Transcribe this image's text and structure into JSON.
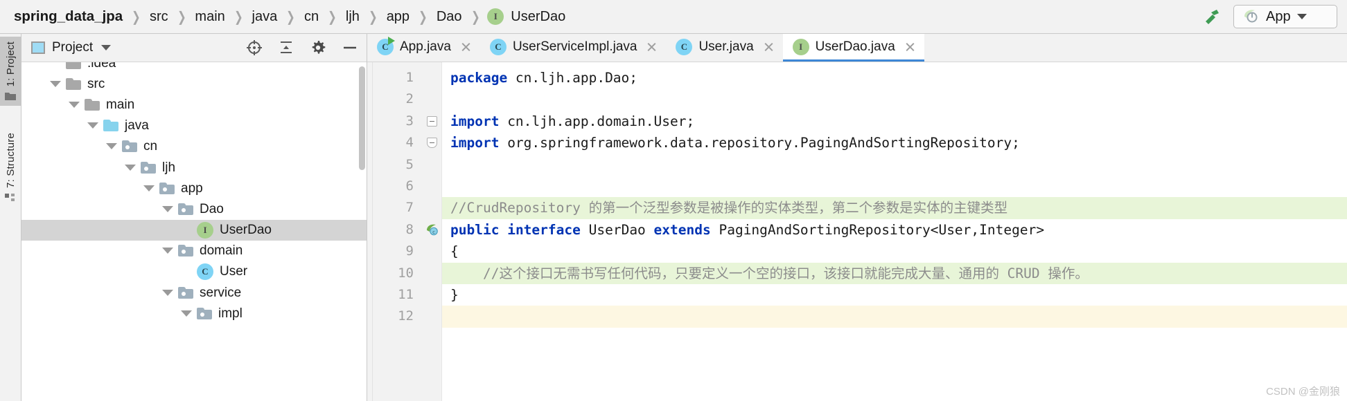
{
  "navbar": {
    "breadcrumb": [
      {
        "label": "spring_data_jpa",
        "root": true,
        "icon": ""
      },
      {
        "label": "src",
        "root": false,
        "icon": ""
      },
      {
        "label": "main",
        "root": false,
        "icon": ""
      },
      {
        "label": "java",
        "root": false,
        "icon": ""
      },
      {
        "label": "cn",
        "root": false,
        "icon": ""
      },
      {
        "label": "ljh",
        "root": false,
        "icon": ""
      },
      {
        "label": "app",
        "root": false,
        "icon": ""
      },
      {
        "label": "Dao",
        "root": false,
        "icon": ""
      },
      {
        "label": "UserDao",
        "root": false,
        "icon": "interface-icon"
      }
    ],
    "separator": "❯",
    "build_icon": "hammer-icon",
    "run_config": {
      "name": "App",
      "icon": "spring-boot-icon",
      "dropdown_icon": "chevron-down-icon"
    }
  },
  "tool_stripe": {
    "buttons": [
      {
        "label": "1: Project",
        "accel": "1",
        "icon": "folder-icon",
        "active": true
      },
      {
        "label": "7: Structure",
        "accel": "7",
        "icon": "structure-icon",
        "active": false
      }
    ]
  },
  "project_panel": {
    "title": "Project",
    "title_icon": "project-view-icon",
    "dropdown_icon": "chevron-down-icon",
    "actions": [
      {
        "name": "select-opened-file-icon",
        "tooltip": "Select Opened File"
      },
      {
        "name": "collapse-all-icon",
        "tooltip": "Collapse All"
      },
      {
        "name": "settings-gear-icon",
        "tooltip": "Settings"
      },
      {
        "name": "hide-panel-icon",
        "tooltip": "Hide"
      }
    ],
    "tree": [
      {
        "label": ".idea",
        "depth": 1,
        "type": "folder-plain",
        "expanded": false,
        "selected": false,
        "clipped": true
      },
      {
        "label": "src",
        "depth": 1,
        "type": "folder-plain",
        "expanded": true,
        "selected": false
      },
      {
        "label": "main",
        "depth": 2,
        "type": "folder-plain",
        "expanded": true,
        "selected": false
      },
      {
        "label": "java",
        "depth": 3,
        "type": "folder-source",
        "expanded": true,
        "selected": false
      },
      {
        "label": "cn",
        "depth": 4,
        "type": "folder-package",
        "expanded": true,
        "selected": false
      },
      {
        "label": "ljh",
        "depth": 5,
        "type": "folder-package",
        "expanded": true,
        "selected": false
      },
      {
        "label": "app",
        "depth": 6,
        "type": "folder-package",
        "expanded": true,
        "selected": false
      },
      {
        "label": "Dao",
        "depth": 7,
        "type": "folder-package",
        "expanded": true,
        "selected": false
      },
      {
        "label": "UserDao",
        "depth": 8,
        "type": "interface",
        "expanded": false,
        "selected": true
      },
      {
        "label": "domain",
        "depth": 7,
        "type": "folder-package",
        "expanded": true,
        "selected": false
      },
      {
        "label": "User",
        "depth": 8,
        "type": "class",
        "expanded": false,
        "selected": false
      },
      {
        "label": "service",
        "depth": 7,
        "type": "folder-package",
        "expanded": true,
        "selected": false
      },
      {
        "label": "impl",
        "depth": 8,
        "type": "folder-package",
        "expanded": true,
        "selected": false
      }
    ]
  },
  "editor": {
    "tabs": [
      {
        "label": "App.java",
        "icon": "class-runnable-icon",
        "active": false,
        "closable": true
      },
      {
        "label": "UserServiceImpl.java",
        "icon": "class-icon",
        "active": false,
        "closable": true
      },
      {
        "label": "User.java",
        "icon": "class-icon",
        "active": false,
        "closable": true
      },
      {
        "label": "UserDao.java",
        "icon": "interface-icon",
        "active": true,
        "closable": true
      }
    ],
    "active_tab_underline_color": "#3d87d6",
    "lines": [
      {
        "num": "1",
        "highlight": "none",
        "gutter": "none",
        "tokens": [
          {
            "t": "package",
            "c": "kw"
          },
          {
            "t": " cn.ljh.app.Dao;",
            "c": "plain"
          }
        ]
      },
      {
        "num": "2",
        "highlight": "none",
        "gutter": "none",
        "tokens": []
      },
      {
        "num": "3",
        "highlight": "none",
        "gutter": "fold-collapse",
        "tokens": [
          {
            "t": "import",
            "c": "kw"
          },
          {
            "t": " cn.ljh.app.domain.User;",
            "c": "plain"
          }
        ]
      },
      {
        "num": "4",
        "highlight": "none",
        "gutter": "fold-end",
        "tokens": [
          {
            "t": "import",
            "c": "kw"
          },
          {
            "t": " org.springframework.data.repository.PagingAndSortingRepository;",
            "c": "plain"
          }
        ]
      },
      {
        "num": "5",
        "highlight": "none",
        "gutter": "none",
        "tokens": []
      },
      {
        "num": "6",
        "highlight": "none",
        "gutter": "none",
        "tokens": []
      },
      {
        "num": "7",
        "highlight": "green",
        "gutter": "none",
        "tokens": [
          {
            "t": "//CrudRepository 的第一个泛型参数是被操作的实体类型，第二个参数是实体的主键类型",
            "c": "cmt"
          }
        ]
      },
      {
        "num": "8",
        "highlight": "none",
        "gutter": "spring-bean",
        "tokens": [
          {
            "t": "public",
            "c": "kw"
          },
          {
            "t": " ",
            "c": "plain"
          },
          {
            "t": "interface",
            "c": "kw"
          },
          {
            "t": " UserDao ",
            "c": "plain"
          },
          {
            "t": "extends",
            "c": "kw"
          },
          {
            "t": " PagingAndSortingRepository<User,Integer>",
            "c": "plain"
          }
        ]
      },
      {
        "num": "9",
        "highlight": "none",
        "gutter": "none",
        "tokens": [
          {
            "t": "{",
            "c": "plain"
          }
        ]
      },
      {
        "num": "10",
        "highlight": "green",
        "gutter": "none",
        "tokens": [
          {
            "t": "    //这个接口无需书写任何代码，只要定义一个空的接口，该接口就能完成大量、通用的 CRUD 操作。",
            "c": "cmt"
          }
        ]
      },
      {
        "num": "11",
        "highlight": "none",
        "gutter": "none",
        "tokens": [
          {
            "t": "}",
            "c": "plain"
          }
        ]
      },
      {
        "num": "12",
        "highlight": "cream",
        "gutter": "none",
        "tokens": []
      }
    ]
  },
  "watermark": {
    "text": "CSDN @金刚狼"
  },
  "colors": {
    "accent_blue": "#3d87d6",
    "keyword_blue": "#0033b3",
    "comment_gray": "#8c8c8c",
    "interface_green": "#a6cf8c",
    "class_blue": "#7fd4f5",
    "selection_gray": "#d4d4d4",
    "comment_highlight_green": "#e8f5d8",
    "caret_line_cream": "#fdf7e2",
    "panel_bg": "#f2f2f2"
  }
}
